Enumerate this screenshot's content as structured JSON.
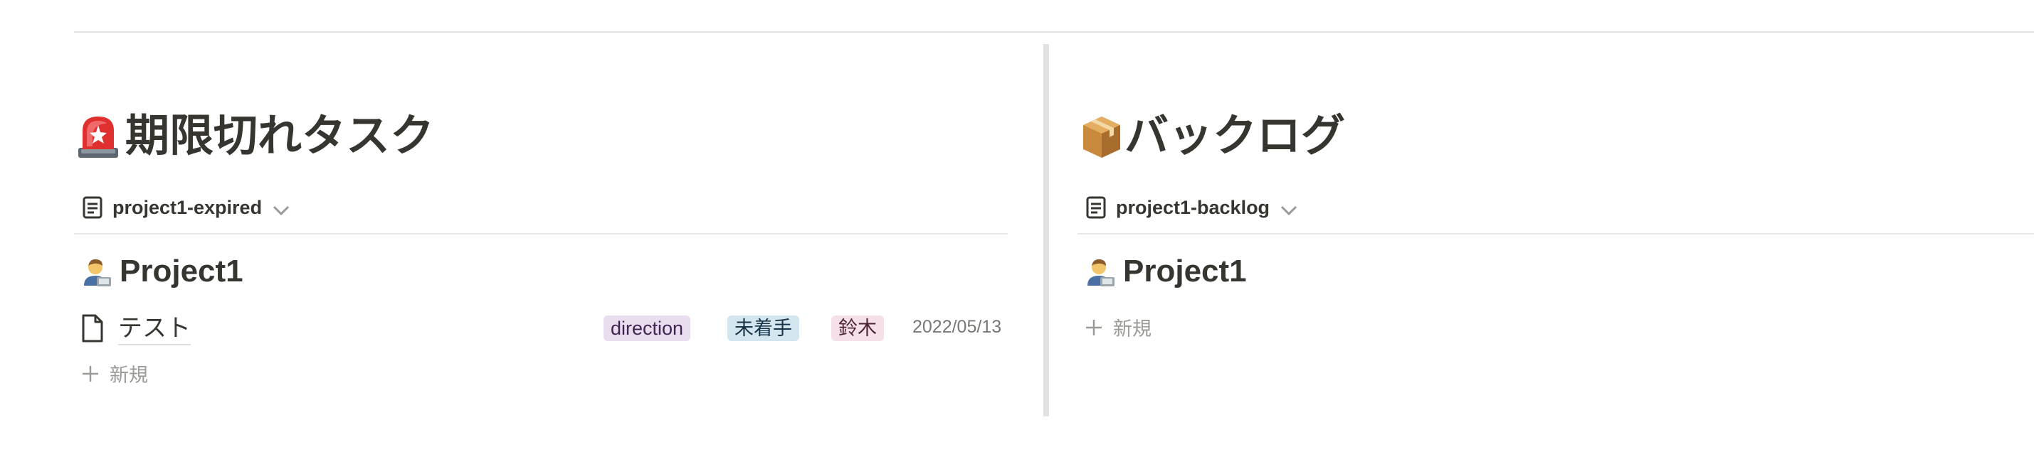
{
  "left_board": {
    "title": "期限切れタスク",
    "title_icon": "rotating-light-icon",
    "view_name": "project1-expired",
    "group": {
      "icon": "technologist-icon",
      "name": "Project1"
    },
    "rows": [
      {
        "title": "テスト",
        "tags": [
          "direction",
          "未着手",
          "鈴木"
        ],
        "date": "2022/05/13"
      }
    ],
    "new_label": "新規"
  },
  "right_board": {
    "title": "バックログ",
    "title_icon": "package-icon",
    "view_name": "project1-backlog",
    "group": {
      "icon": "technologist-icon",
      "name": "Project1"
    },
    "new_label": "新規"
  },
  "colors": {
    "text": "#37352f",
    "muted": "#9b9a97",
    "tag_direction": "#e8deee",
    "tag_status": "#d3e5ef",
    "tag_assignee": "#f5e0e9",
    "divider": "#e3e2e0"
  }
}
